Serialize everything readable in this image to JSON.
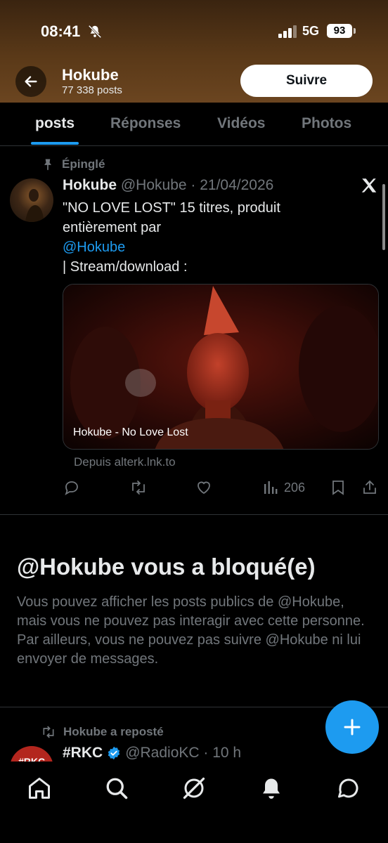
{
  "status_bar": {
    "time": "08:41",
    "network": "5G",
    "battery": "93"
  },
  "header": {
    "name": "Hokube",
    "post_count": "77 338 posts",
    "follow_label": "Suivre"
  },
  "tabs": [
    {
      "label": "posts"
    },
    {
      "label": "Réponses"
    },
    {
      "label": "Vidéos"
    },
    {
      "label": "Photos"
    }
  ],
  "pinned_post": {
    "pinned_label": "Épinglé",
    "author_name": "Hokube",
    "meta": "@Hokube · 21/04/2026",
    "text_line1": "\"NO LOVE LOST\" 15 titres, produit",
    "text_line2": "entièrement par",
    "mention": "@Hokube",
    "text_line4": "| Stream/download :",
    "media_caption": "Hokube - No Love Lost",
    "source": "Depuis alterk.lnk.to",
    "views": "206"
  },
  "blocked": {
    "title": "@Hokube vous a bloqué(e)",
    "body": "Vous pouvez afficher les posts publics de @Hokube, mais vous ne pouvez pas interagir avec cette personne. Par ailleurs, vous ne pouvez pas suivre @Hokube ni lui envoyer de messages."
  },
  "repost": {
    "label": "Hokube a reposté",
    "author_name": "#RKC",
    "meta": "@RadioKC · 10 h",
    "avatar_text": "#RKC"
  },
  "colors": {
    "accent": "#1d9bf0",
    "muted": "#71767b",
    "text": "#e7e9ea"
  }
}
